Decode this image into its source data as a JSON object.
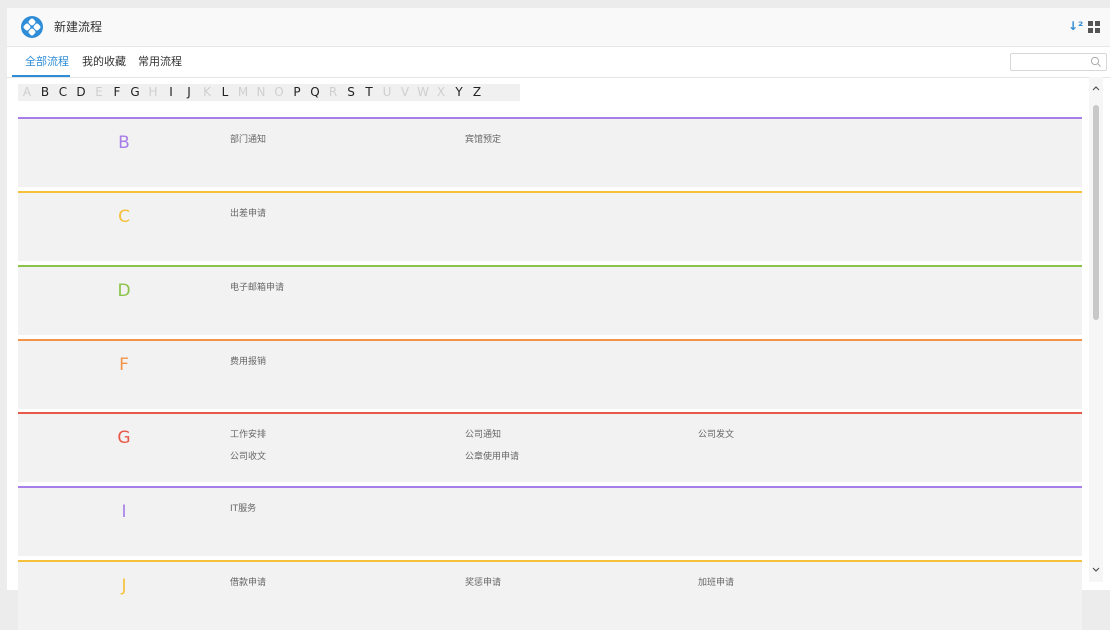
{
  "header": {
    "title": "新建流程",
    "sort_icon": "sort-alpha-icon",
    "grid_icon": "grid-view-icon"
  },
  "tabs": [
    {
      "label": "全部流程",
      "active": true
    },
    {
      "label": "我的收藏",
      "active": false
    },
    {
      "label": "常用流程",
      "active": false
    }
  ],
  "search": {
    "placeholder": "",
    "icon": "search-icon"
  },
  "alphabet": [
    {
      "letter": "A",
      "enabled": false
    },
    {
      "letter": "B",
      "enabled": true
    },
    {
      "letter": "C",
      "enabled": true
    },
    {
      "letter": "D",
      "enabled": true
    },
    {
      "letter": "E",
      "enabled": false
    },
    {
      "letter": "F",
      "enabled": true
    },
    {
      "letter": "G",
      "enabled": true
    },
    {
      "letter": "H",
      "enabled": false
    },
    {
      "letter": "I",
      "enabled": true
    },
    {
      "letter": "J",
      "enabled": true
    },
    {
      "letter": "K",
      "enabled": false
    },
    {
      "letter": "L",
      "enabled": true
    },
    {
      "letter": "M",
      "enabled": false
    },
    {
      "letter": "N",
      "enabled": false
    },
    {
      "letter": "O",
      "enabled": false
    },
    {
      "letter": "P",
      "enabled": true
    },
    {
      "letter": "Q",
      "enabled": true
    },
    {
      "letter": "R",
      "enabled": false
    },
    {
      "letter": "S",
      "enabled": true
    },
    {
      "letter": "T",
      "enabled": true
    },
    {
      "letter": "U",
      "enabled": false
    },
    {
      "letter": "V",
      "enabled": false
    },
    {
      "letter": "W",
      "enabled": false
    },
    {
      "letter": "X",
      "enabled": false
    },
    {
      "letter": "Y",
      "enabled": true
    },
    {
      "letter": "Z",
      "enabled": true
    }
  ],
  "sections": [
    {
      "letter": "B",
      "color": "#a77ee8",
      "items": [
        "部门通知",
        "宾馆预定"
      ]
    },
    {
      "letter": "C",
      "color": "#f5c03a",
      "items": [
        "出差申请"
      ]
    },
    {
      "letter": "D",
      "color": "#8bc34a",
      "items": [
        "电子邮箱申请"
      ]
    },
    {
      "letter": "F",
      "color": "#f39348",
      "items": [
        "费用报销"
      ]
    },
    {
      "letter": "G",
      "color": "#e9594a",
      "items": [
        "工作安排",
        "公司通知",
        "公司发文",
        "公司收文",
        "公章使用申请"
      ]
    },
    {
      "letter": "I",
      "color": "#a77ee8",
      "items": [
        "IT服务"
      ]
    },
    {
      "letter": "J",
      "color": "#f5c03a",
      "items": [
        "借款申请",
        "奖惩申请",
        "加班申请"
      ]
    }
  ],
  "colors": {
    "accent": "#2f8dd8"
  }
}
